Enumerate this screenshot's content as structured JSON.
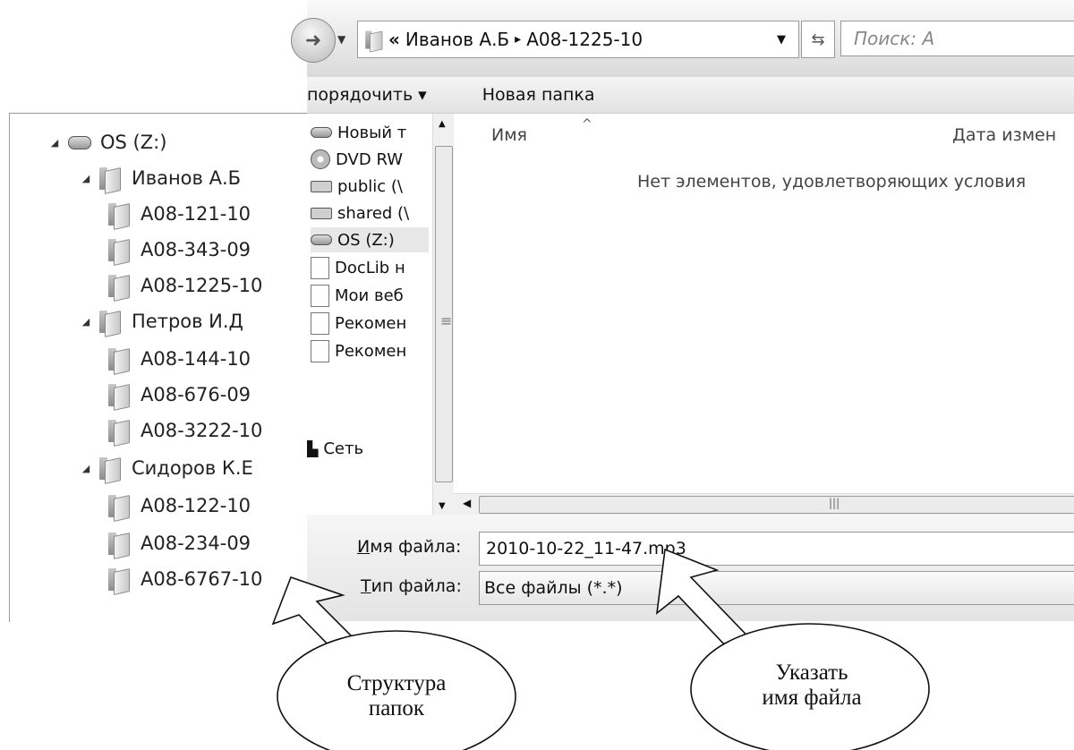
{
  "tree": {
    "items": [
      {
        "label": "OS (Z:)",
        "level": 0,
        "type": "drive",
        "expanded": true
      },
      {
        "label": "Иванов А.Б",
        "level": 1,
        "type": "folder",
        "expanded": true
      },
      {
        "label": "A08-121-10",
        "level": 2,
        "type": "folder"
      },
      {
        "label": "A08-343-09",
        "level": 2,
        "type": "folder"
      },
      {
        "label": "A08-1225-10",
        "level": 2,
        "type": "folder"
      },
      {
        "label": "Петров И.Д",
        "level": 1,
        "type": "folder",
        "expanded": true
      },
      {
        "label": "A08-144-10",
        "level": 2,
        "type": "folder"
      },
      {
        "label": "A08-676-09",
        "level": 2,
        "type": "folder"
      },
      {
        "label": "A08-3222-10",
        "level": 2,
        "type": "folder"
      },
      {
        "label": "Сидоров К.Е",
        "level": 1,
        "type": "folder",
        "expanded": true
      },
      {
        "label": "A08-122-10",
        "level": 2,
        "type": "folder"
      },
      {
        "label": "A08-234-09",
        "level": 2,
        "type": "folder"
      },
      {
        "label": "A08-6767-10",
        "level": 2,
        "type": "folder"
      }
    ]
  },
  "address": {
    "chevron": "«",
    "parent": "Иванов А.Б",
    "separator": "▸",
    "current": "A08-1225-10",
    "search_placeholder": "Поиск: A"
  },
  "toolbar": {
    "organize": "порядочить ▾",
    "new_folder": "Новая папка"
  },
  "nav_pane": {
    "items": [
      {
        "label": "Новый т",
        "icon": "drive-icon"
      },
      {
        "label": "DVD RW",
        "icon": "disc-icon"
      },
      {
        "label": "public (\\",
        "icon": "network-drive-icon"
      },
      {
        "label": "shared (\\",
        "icon": "network-drive-icon"
      },
      {
        "label": "OS (Z:)",
        "icon": "drive-icon"
      },
      {
        "label": "DocLib н",
        "icon": "document-icon"
      },
      {
        "label": "Мои веб",
        "icon": "document-icon"
      },
      {
        "label": "Рекомен",
        "icon": "document-icon"
      },
      {
        "label": "Рекомен",
        "icon": "document-icon"
      },
      {
        "label": "Сеть",
        "icon": "network-icon"
      }
    ]
  },
  "file_list": {
    "col_name": "Имя",
    "col_date": "Дата измен",
    "empty_message": "Нет элементов, удовлетворяющих условия"
  },
  "bottom": {
    "filename_label_u": "И",
    "filename_label_rest": "мя файла:",
    "filename_value": "2010-10-22_11-47.mp3",
    "filetype_label_u": "Т",
    "filetype_label_rest": "ип файла:",
    "filetype_value": "Все файлы  (*.*)"
  },
  "callouts": {
    "left_line1": "Структура",
    "left_line2": "папок",
    "right_line1": "Указать",
    "right_line2": "имя файла"
  }
}
